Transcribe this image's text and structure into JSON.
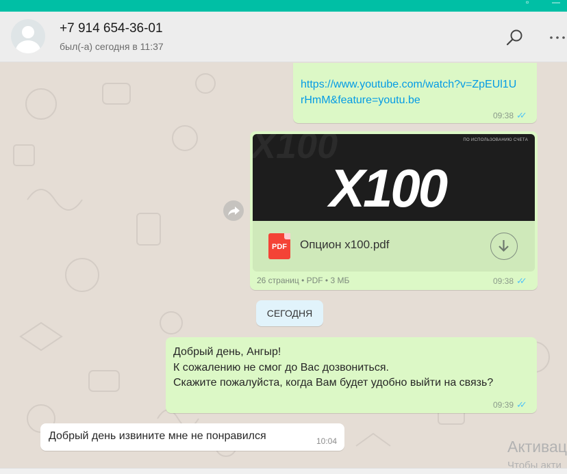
{
  "window": {
    "restore_icon": "restore-icon",
    "close_icon": "close-icon"
  },
  "contact": {
    "name": "+7 914 654-36-01",
    "status": "был(-а) сегодня в 11:37"
  },
  "header_icons": [
    "search-icon",
    "more-icon"
  ],
  "messages": {
    "link": {
      "text": "https://www.youtube.com/watch?v=ZpEUl1UrHmM&feature=youtu.be",
      "time": "09:38",
      "ticks": "✓✓"
    },
    "document": {
      "preview_title": "X100",
      "preview_bg_text": "X100",
      "preview_small_text": "ПО ИСПОЛЬЗОВАНИЮ СЧЕТА",
      "file_icon_label": "PDF",
      "file_name": "Опцион x100.pdf",
      "info": "26 страниц • PDF • 3 МБ",
      "time": "09:38",
      "ticks": "✓✓"
    },
    "date_separator": "СЕГОДНЯ",
    "outgoing_text": {
      "lines": [
        "Добрый день, Ангыр!",
        "К сожалению не смог до Вас дозвониться.",
        "Скажите пожалуйста, когда Вам будет удобно выйти на связь?"
      ],
      "time": "09:39",
      "ticks": "✓✓"
    },
    "incoming_text": {
      "text": "Добрый день извините мне не понравился",
      "time": "10:04"
    }
  },
  "watermark": {
    "title": "Активац",
    "subtitle": "Чтобы акти"
  },
  "colors": {
    "accent": "#00bfa5",
    "outgoing_bubble": "#dcf8c6",
    "incoming_bubble": "#ffffff",
    "link": "#039be5",
    "read_ticks": "#4fc3f7",
    "pdf_red": "#f44336"
  }
}
